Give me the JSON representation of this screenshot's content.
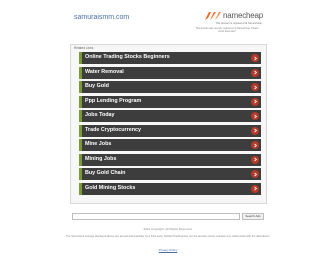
{
  "header": {
    "site_name": "samuraismm.com",
    "brand": "namecheap",
    "registrar_text": "This domain is registered at Namecheap",
    "notice_text": "This domain was recently registered at Namecheap. Please check back later!",
    "brand_color": "#f26522"
  },
  "panel": {
    "title": "Related Links",
    "accent_color": "#7a9a3a",
    "items": [
      {
        "label": "Online Trading Stocks Beginners"
      },
      {
        "label": "Water Removal"
      },
      {
        "label": "Buy Gold"
      },
      {
        "label": "Ppp Lending Program"
      },
      {
        "label": "Jobs Today"
      },
      {
        "label": "Trade Cryptocurrency"
      },
      {
        "label": "Mine Jobs"
      },
      {
        "label": "Mining Jobs"
      },
      {
        "label": "Buy Gold Chain"
      },
      {
        "label": "Gold Mining Stocks"
      }
    ]
  },
  "search": {
    "placeholder": "",
    "button_label": "Search Ads"
  },
  "footer": {
    "copyright": "2021 Copyright. All Rights Reserved.",
    "disclaimer": "The Sponsored Listings displayed above are served automatically by a third party. Neither Parkingcrew nor the domain owner maintain any relationship with the advertisers.",
    "privacy_label": "Privacy Policy"
  }
}
